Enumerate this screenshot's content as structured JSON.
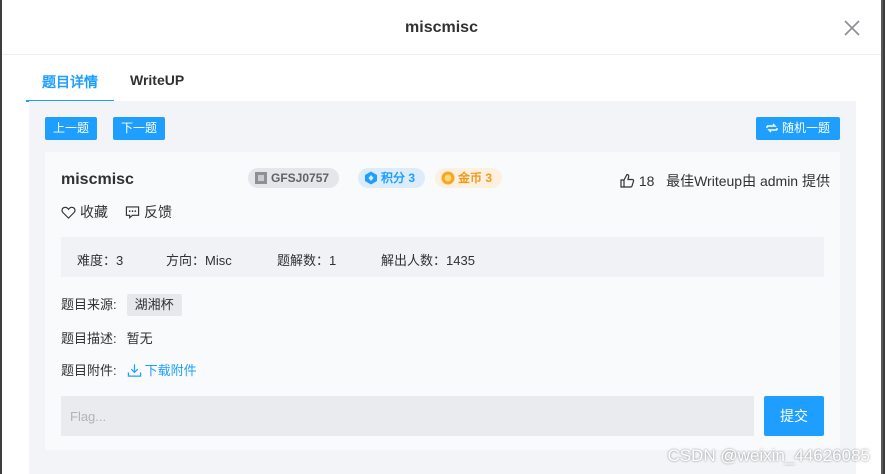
{
  "modal": {
    "title": "miscmisc"
  },
  "tabs": [
    {
      "label": "题目详情",
      "active": true
    },
    {
      "label": "WriteUP",
      "active": false
    }
  ],
  "toolbar": {
    "prev_label": "上一题",
    "next_label": "下一题",
    "random_label": "随机一题"
  },
  "challenge": {
    "title": "miscmisc",
    "id_badge": "GFSJ0757",
    "score_badge": "积分 3",
    "coin_badge": "金币 3",
    "likes": "18",
    "best_writeup": "最佳Writeup由 admin 提供",
    "favorite_label": "收藏",
    "feedback_label": "反馈"
  },
  "stats": {
    "difficulty": "难度：3",
    "direction": "方向：Misc",
    "writeup_count": "题解数：1",
    "solvers": "解出人数：1435"
  },
  "info": {
    "source_label": "题目来源:",
    "source_value": "湖湘杯",
    "desc_label": "题目描述:",
    "desc_value": "暂无",
    "attach_label": "题目附件:",
    "attach_link": "下载附件"
  },
  "flag": {
    "placeholder": "Flag...",
    "submit_label": "提交"
  },
  "watermark": "CSDN @weixin_44626085",
  "colors": {
    "accent": "#1e9fff",
    "coin": "#f09a1a"
  }
}
